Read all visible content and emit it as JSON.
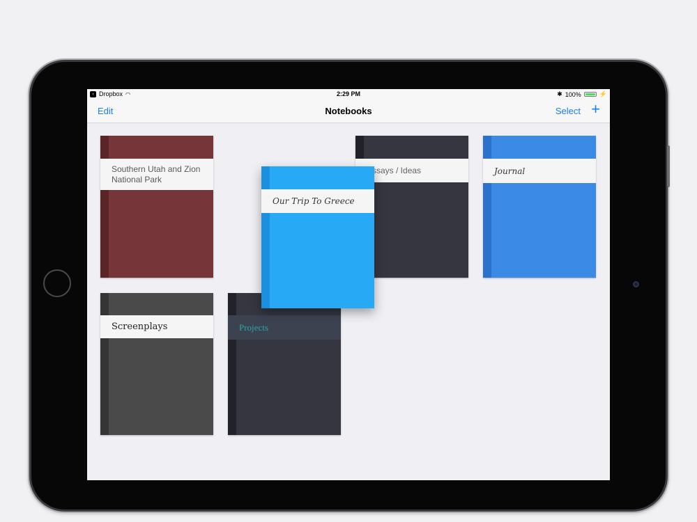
{
  "status_bar": {
    "back_app": "Dropbox",
    "time": "2:29 PM",
    "battery": "100%"
  },
  "nav": {
    "edit_label": "Edit",
    "title": "Notebooks",
    "select_label": "Select",
    "add_label": "+"
  },
  "notebooks": [
    {
      "title": "Southern Utah and Zion National Park",
      "color": "#763538"
    },
    {
      "title": "Essays / Ideas",
      "color": "#363640"
    },
    {
      "title": "Journal",
      "color": "#3b8be6"
    },
    {
      "title": "Screenplays",
      "color": "#4a4a4a"
    },
    {
      "title": "Projects",
      "color": "#363640"
    }
  ],
  "dragging_notebook": {
    "title": "Our Trip To Greece",
    "color": "#28a9f6"
  }
}
